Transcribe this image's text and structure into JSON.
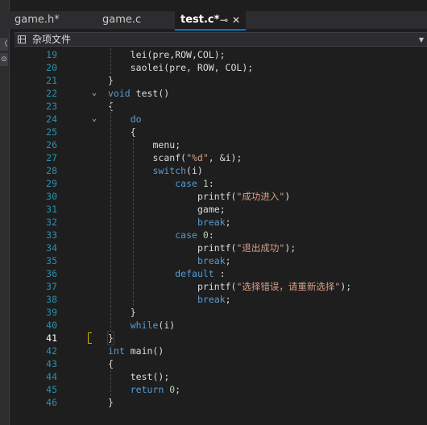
{
  "tabs": [
    {
      "label": "game.h*",
      "active": false
    },
    {
      "label": "game.c",
      "active": false
    },
    {
      "label": "test.c*",
      "active": true
    }
  ],
  "active_tab_icons": {
    "pin": "pin-icon",
    "close": "close-icon"
  },
  "strip_buttons": [
    "〈",
    "⊙"
  ],
  "navbar": {
    "scope_label": "杂项文件",
    "dropdown_icon": "chevron-down-icon"
  },
  "lines": [
    {
      "n": "19",
      "code": "        lei(pre,ROW,COL);"
    },
    {
      "n": "20",
      "code": "        saolei(pre, ROW, COL);"
    },
    {
      "n": "21",
      "code": "    }"
    },
    {
      "n": "22",
      "code": "    void test()"
    },
    {
      "n": "23",
      "code": "    {"
    },
    {
      "n": "24",
      "code": "        do"
    },
    {
      "n": "25",
      "code": "        {"
    },
    {
      "n": "26",
      "code": "            menu;"
    },
    {
      "n": "27",
      "code": "            scanf(\"%d\", &i);"
    },
    {
      "n": "28",
      "code": "            switch(i)"
    },
    {
      "n": "29",
      "code": "                case 1:"
    },
    {
      "n": "30",
      "code": "                    printf(\"成功进入\")"
    },
    {
      "n": "31",
      "code": "                    game;"
    },
    {
      "n": "32",
      "code": "                    break;"
    },
    {
      "n": "33",
      "code": "                case 0:"
    },
    {
      "n": "34",
      "code": "                    printf(\"退出成功\");"
    },
    {
      "n": "35",
      "code": "                    break;"
    },
    {
      "n": "36",
      "code": "                default :"
    },
    {
      "n": "37",
      "code": "                    printf(\"选择错误，请重新选择\");"
    },
    {
      "n": "38",
      "code": "                    break;"
    },
    {
      "n": "39",
      "code": "        }"
    },
    {
      "n": "40",
      "code": "        while(i)"
    },
    {
      "n": "41",
      "code": "    }"
    },
    {
      "n": "42",
      "code": "    int main()"
    },
    {
      "n": "43",
      "code": "    {"
    },
    {
      "n": "44",
      "code": "        test();"
    },
    {
      "n": "45",
      "code": "        return 0;"
    },
    {
      "n": "46",
      "code": "    }"
    }
  ],
  "current_line": "41",
  "colors": {
    "keyword": "#569cd6",
    "string": "#d69d85",
    "number": "#b5cea8",
    "text": "#dcdcdc",
    "line_number": "#2b91af",
    "accent": "#007acc"
  }
}
